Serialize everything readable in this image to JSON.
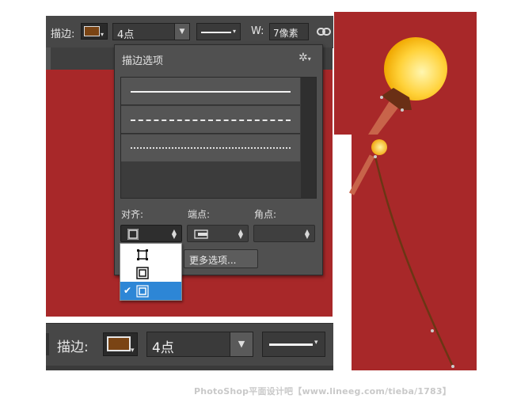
{
  "top_toolbar": {
    "stroke_label": "描边:",
    "stroke_width_value": "4点",
    "width_label": "W:",
    "width_value": "7像素"
  },
  "stroke_options_panel": {
    "title": "描边选项",
    "line_styles": [
      "solid",
      "dashed",
      "dotted"
    ],
    "align_label": "对齐:",
    "caps_label": "端点:",
    "corners_label": "角点:",
    "more_options_button": "更多选项...",
    "align_menu": {
      "options": [
        "inside",
        "center",
        "outside"
      ],
      "selected_index": 2,
      "check_mark": "✔"
    }
  },
  "bottom_toolbar": {
    "stroke_label": "描边:",
    "stroke_width_value": "4点"
  },
  "colors": {
    "canvas_red": "#a82829",
    "stroke_swatch": "#7a4414",
    "toolbar_bg": "#474747",
    "panel_bg": "#505050",
    "highlight_blue": "#2d86d6"
  },
  "watermark": "PhotoShop平面设计吧【www.lineeg.com/tieba/1783】"
}
